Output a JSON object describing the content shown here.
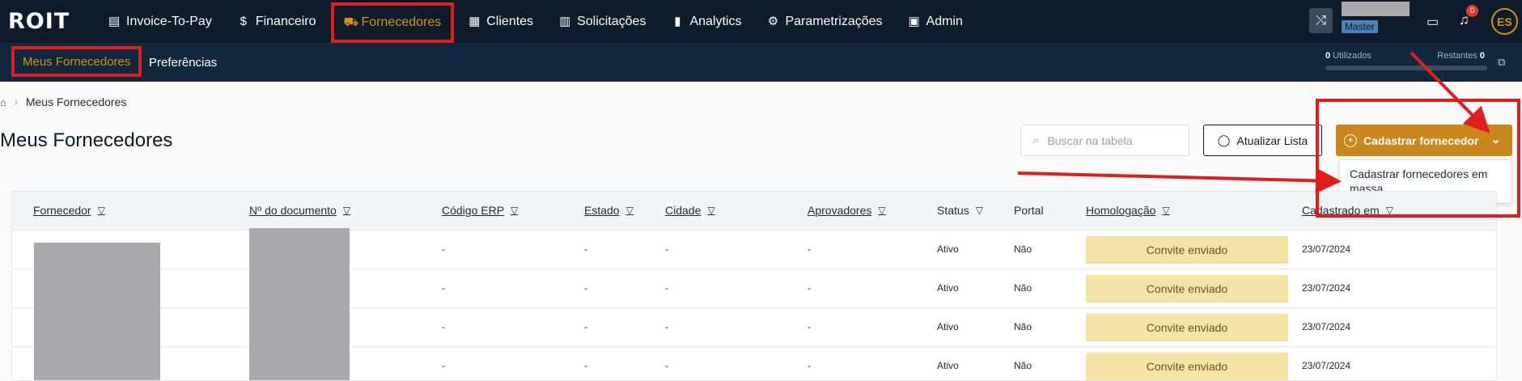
{
  "app": {
    "logo": "ROIT"
  },
  "nav": {
    "items": [
      {
        "label": "Invoice-To-Pay",
        "icon": "invoice-icon"
      },
      {
        "label": "Financeiro",
        "icon": "dollar-icon"
      },
      {
        "label": "Fornecedores",
        "icon": "truck-icon"
      },
      {
        "label": "Clientes",
        "icon": "building-icon"
      },
      {
        "label": "Solicitações",
        "icon": "clipboard-icon"
      },
      {
        "label": "Analytics",
        "icon": "chart-icon"
      },
      {
        "label": "Parametrizações",
        "icon": "gear-icon"
      },
      {
        "label": "Admin",
        "icon": "admin-icon"
      }
    ],
    "active": "Fornecedores"
  },
  "user": {
    "role": "Master",
    "initials": "ES",
    "notifications": "0"
  },
  "subnav": {
    "items": [
      "Meus Fornecedores",
      "Preferências"
    ],
    "active": "Meus Fornecedores"
  },
  "usage": {
    "used_value": "0",
    "used_label": "Utilizados",
    "remaining_label": "Restantes",
    "remaining_value": "0"
  },
  "breadcrumb": [
    "Meus Fornecedores"
  ],
  "page": {
    "title": "Meus Fornecedores"
  },
  "toolbar": {
    "search_placeholder": "Buscar na tabela",
    "refresh_label": "Atualizar Lista",
    "register_label": "Cadastrar fornecedor",
    "dropdown_item": "Cadastrar fornecedores em massa"
  },
  "table": {
    "columns": [
      "Fornecedor",
      "Nº do documento",
      "Código ERP",
      "Estado",
      "Cidade",
      "Aprovadores",
      "Status",
      "Portal",
      "Homologação",
      "Cadastrado em"
    ],
    "rows": [
      {
        "erp": "-",
        "estado": "-",
        "cidade": "-",
        "aprovadores": "-",
        "status": "Ativo",
        "portal": "Não",
        "homologacao": "Convite enviado",
        "cadastrado": "23/07/2024"
      },
      {
        "erp": "-",
        "estado": "-",
        "cidade": "-",
        "aprovadores": "-",
        "status": "Ativo",
        "portal": "Não",
        "homologacao": "Convite enviado",
        "cadastrado": "23/07/2024"
      },
      {
        "erp": "-",
        "estado": "-",
        "cidade": "-",
        "aprovadores": "-",
        "status": "Ativo",
        "portal": "Não",
        "homologacao": "Convite enviado",
        "cadastrado": "23/07/2024"
      },
      {
        "erp": "-",
        "estado": "-",
        "cidade": "-",
        "aprovadores": "-",
        "status": "Ativo",
        "portal": "Não",
        "homologacao": "Convite enviado",
        "cadastrado": "23/07/2024"
      }
    ]
  },
  "colors": {
    "accent": "#c9871e",
    "nav_bg": "#0d1b2a",
    "annotation": "#e01e1e",
    "badge": "#f6e3a6"
  }
}
